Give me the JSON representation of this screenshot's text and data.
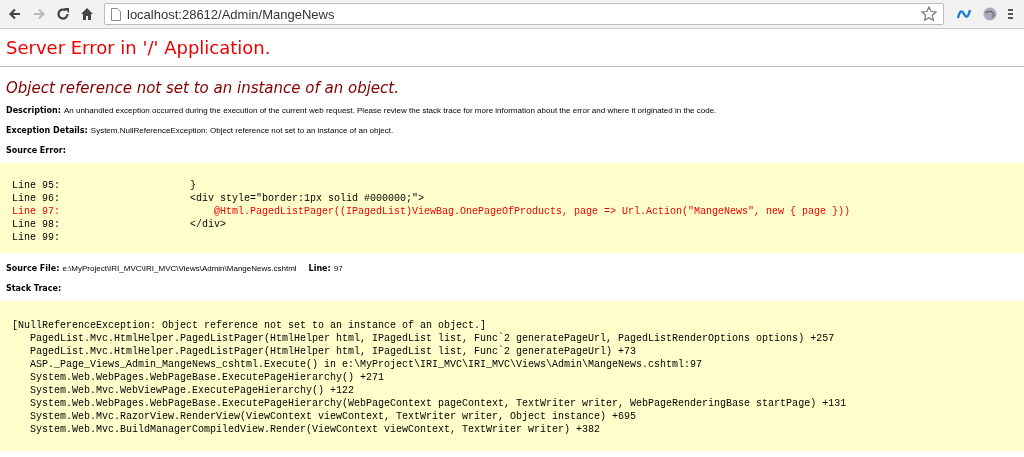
{
  "browser": {
    "buttons": [
      {
        "kind": "back",
        "disabled": false
      },
      {
        "kind": "forward",
        "disabled": true
      },
      {
        "kind": "reload",
        "disabled": false
      },
      {
        "kind": "home",
        "disabled": false
      }
    ],
    "address": "localhost:28612/Admin/MangeNews"
  },
  "title": "Server Error in '/' Application.",
  "error_message": "Object reference not set to an instance of an object.",
  "details": [
    {
      "label": "Description:",
      "text": "An unhandled exception occurred during the execution of the current web request. Please review the stack trace for more information about the error and where it originated in the code."
    },
    {
      "label": "Exception Details:",
      "text": "System.NullReferenceException: Object reference not set to an instance of an object."
    }
  ],
  "source_error": {
    "heading": "Source Error:",
    "lines": [
      {
        "number": "Line 95:",
        "code": "}",
        "error": false
      },
      {
        "number": "Line 96:",
        "code": "<div style=\"border:1px solid #000000;\">",
        "error": false
      },
      {
        "number": "Line 97:",
        "code": "    @Html.PagedListPager((IPagedList)ViewBag.OnePageOfProducts, page => Url.Action(\"MangeNews\", new { page }))",
        "error": true
      },
      {
        "number": "Line 98:",
        "code": "</div>",
        "error": false
      },
      {
        "number": "Line 99:",
        "error": false
      }
    ]
  },
  "source_file": {
    "label": "Source File:",
    "path": "e:\\MyProject\\IRI_MVC\\IRI_MVC\\Views\\Admin\\MangeNews.cshtml",
    "line_label": "Line:",
    "line": "97"
  },
  "stack_trace": {
    "heading": "Stack Trace:",
    "exception": "[NullReferenceException: Object reference not set to an instance of an object.]",
    "frames": [
      "PagedList.Mvc.HtmlHelper.PagedListPager(HtmlHelper html, IPagedList list, Func`2 generatePageUrl, PagedListRenderOptions options) +257",
      "PagedList.Mvc.HtmlHelper.PagedListPager(HtmlHelper html, IPagedList list, Func`2 generatePageUrl) +73",
      "ASP._Page_Views_Admin_MangeNews_cshtml.Execute() in e:\\MyProject\\IRI_MVC\\IRI_MVC\\Views\\Admin\\MangeNews.cshtml:97",
      "System.Web.WebPages.WebPageBase.ExecutePageHierarchy() +271",
      "System.Web.Mvc.WebViewPage.ExecutePageHierarchy() +122",
      "System.Web.WebPages.WebPageBase.ExecutePageHierarchy(WebPageContext pageContext, TextWriter writer, WebPageRenderingBase startPage) +131",
      "System.Web.Mvc.RazorView.RenderView(ViewContext viewContext, TextWriter writer, Object instance) +695",
      "System.Web.Mvc.BuildManagerCompiledView.Render(ViewContext viewContext, TextWriter writer) +382"
    ]
  }
}
